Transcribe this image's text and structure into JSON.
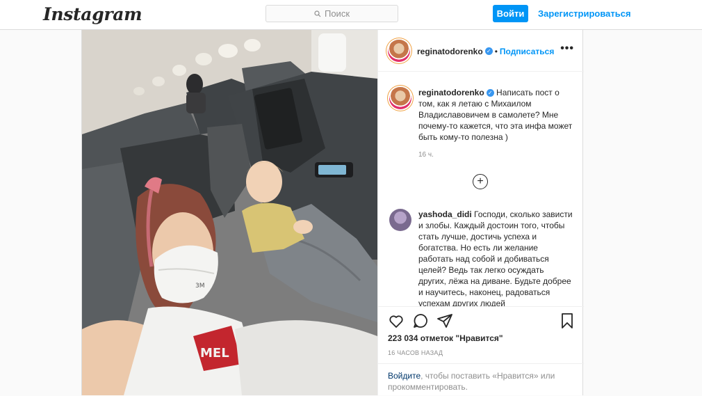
{
  "header": {
    "logo": "Instagram",
    "search_placeholder": "Поиск",
    "login_label": "Войти",
    "signup_label": "Зарегистрироваться"
  },
  "post": {
    "author": "reginatodorenko",
    "follow_label": "Подписаться",
    "separator": "•",
    "more_label": "•••",
    "caption": "Написать пост о том, как я летаю с Михаилом Владиславовичем в самолете? Мне почему-то кажется, что эта инфа может быть кому-то полезна )",
    "caption_time": "16 ч.",
    "load_more_label": "+",
    "comments": [
      {
        "author": "yashoda_didi",
        "text": "Господи, сколько зависти и злобы. Каждый достоин того, чтобы стать лучше, достичь успеха и богатства. Но есть ли желание работать над собой и добиваться целей? Ведь так легко осуждать других, лёжа на диване. Будьте добрее и научитесь, наконец, радоваться успехам других людей"
      }
    ],
    "likes": "223 034 отметок \"Нравится\"",
    "posted_ago": "16 ЧАСОВ НАЗАД",
    "login_link": "Войдите",
    "login_note": ", чтобы поставить «Нравится» или прокомментировать."
  },
  "icons": {
    "search": "search-icon",
    "verified": "verified-badge-icon",
    "like": "heart-icon",
    "comment": "comment-icon",
    "share": "share-icon",
    "save": "bookmark-icon"
  },
  "colors": {
    "accent": "#0095f6",
    "verified": "#3897f0",
    "link_dark": "#00376b"
  }
}
